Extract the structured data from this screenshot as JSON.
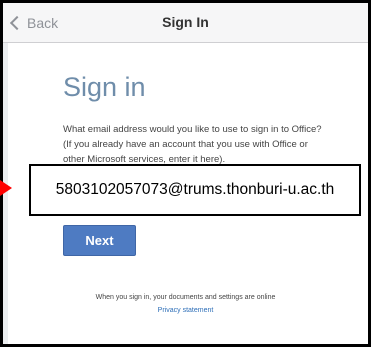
{
  "navbar": {
    "back_label": "Back",
    "title": "Sign In"
  },
  "main": {
    "heading": "Sign in",
    "description": "What email address would you like to use to sign in to Office? (If you already have an account that you use with Office or other Microsoft services, enter it here).",
    "email_value": "5803102057073@trums.thonburi-u.ac.th",
    "next_label": "Next",
    "footer_text": "When you sign in, your documents and settings are online",
    "privacy_label": "Privacy statement"
  },
  "icons": {
    "back": "chevron-left-icon",
    "annotation": "arrow-right-icon"
  },
  "colors": {
    "heading": "#6f8daa",
    "button": "#4e7bc2",
    "link": "#2e6fb8",
    "annotation_arrow": "#ff0000"
  }
}
